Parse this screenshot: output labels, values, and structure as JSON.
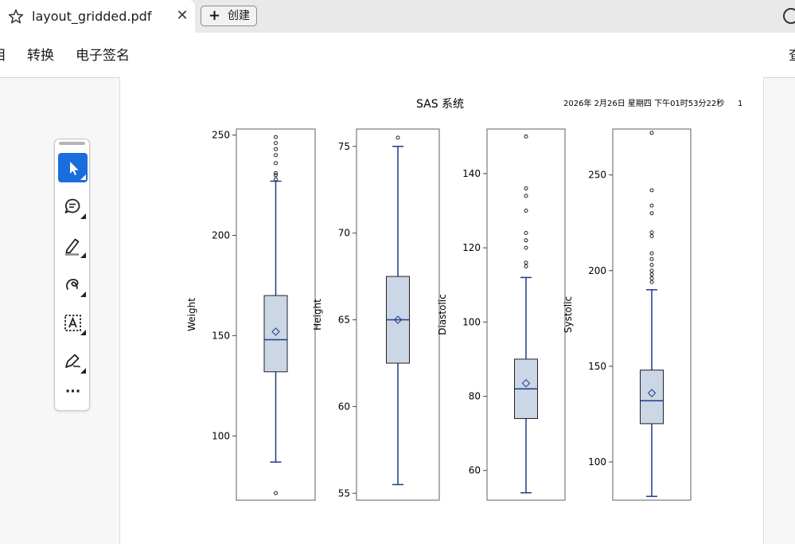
{
  "tab": {
    "title": "layout_gridded.pdf",
    "close_glyph": "✕"
  },
  "create_button": {
    "label": "创建"
  },
  "menubar": {
    "items": [
      "目",
      "转换",
      "电子签名",
      "查"
    ]
  },
  "toolbar": {
    "tools": [
      {
        "name": "select-pointer-icon",
        "active": true
      },
      {
        "name": "add-comment-icon",
        "active": false
      },
      {
        "name": "highlight-pen-icon",
        "active": false
      },
      {
        "name": "freehand-draw-icon",
        "active": false
      },
      {
        "name": "text-box-icon",
        "active": false
      },
      {
        "name": "fill-sign-icon",
        "active": false
      },
      {
        "name": "more-icon",
        "active": false
      }
    ],
    "more_glyph": "···"
  },
  "document": {
    "title": "SAS 系统",
    "date": "2026年 2月26日 星期四 下午01时53分22秒",
    "page_number": "1"
  },
  "colors": {
    "box_fill": "#cbd6e6",
    "box_line": "#1f3b8a",
    "accent": "#1a6ddc"
  },
  "chart_data": [
    {
      "type": "box",
      "ylabel": "Weight",
      "ylim": [
        68,
        253
      ],
      "ticks": [
        100,
        150,
        200,
        250
      ],
      "q1": 132,
      "median": 148,
      "q3": 170,
      "whisker_low": 87,
      "whisker_high": 227,
      "mean": 152,
      "outliers": [
        71.5,
        228,
        230,
        231,
        236,
        240,
        243,
        246,
        249
      ]
    },
    {
      "type": "box",
      "ylabel": "Height",
      "ylim": [
        54.6,
        76
      ],
      "ticks": [
        55,
        60,
        65,
        70,
        75
      ],
      "q1": 62.5,
      "median": 65,
      "q3": 67.5,
      "whisker_low": 55.5,
      "whisker_high": 75,
      "mean": 65,
      "outliers": [
        75.5
      ]
    },
    {
      "type": "box",
      "ylabel": "Diastolic",
      "ylim": [
        52,
        152
      ],
      "ticks": [
        60,
        80,
        100,
        120,
        140
      ],
      "q1": 74,
      "median": 82,
      "q3": 90,
      "whisker_low": 54,
      "whisker_high": 112,
      "mean": 83.5,
      "outliers": [
        115,
        116,
        120,
        122,
        124,
        130,
        134,
        136,
        150
      ]
    },
    {
      "type": "box",
      "ylabel": "Systolic",
      "ylim": [
        80,
        274
      ],
      "ticks": [
        100,
        150,
        200,
        250
      ],
      "q1": 120,
      "median": 132,
      "q3": 148,
      "whisker_low": 82,
      "whisker_high": 190,
      "mean": 136,
      "outliers": [
        194,
        196,
        198,
        200,
        203,
        206,
        209,
        218,
        220,
        230,
        234,
        242,
        272
      ]
    }
  ]
}
